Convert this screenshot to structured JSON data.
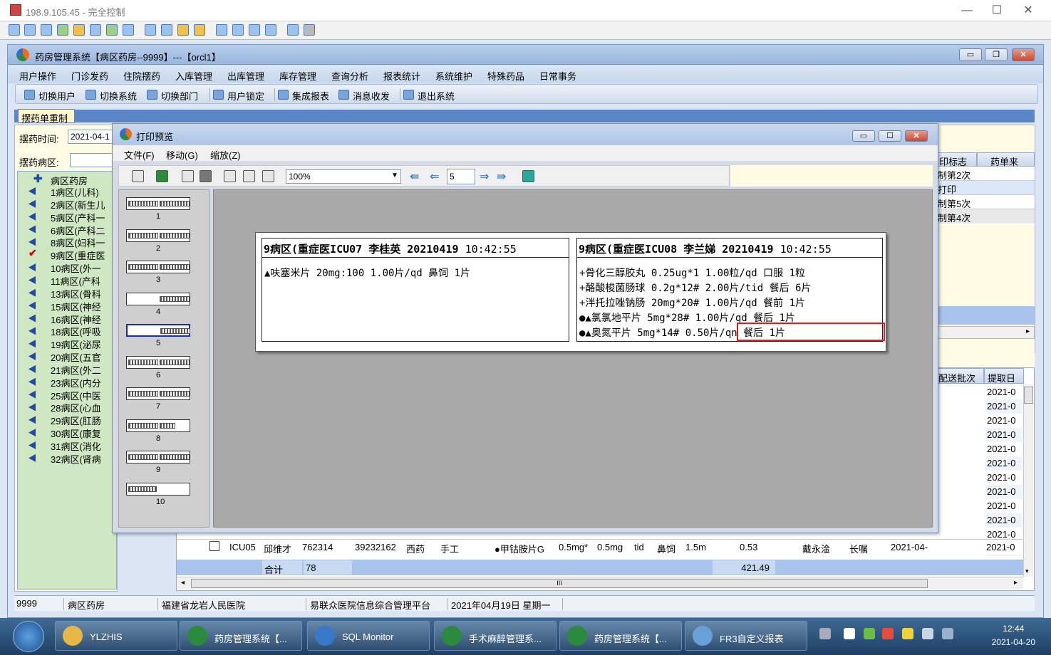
{
  "remote": {
    "title": "198.9.105.45 - 完全控制",
    "controls": [
      "—",
      "☐",
      "✕"
    ]
  },
  "app": {
    "title": "药房管理系统【病区药房--9999】---【orcl1】"
  },
  "menu": [
    "用户操作",
    "门诊发药",
    "住院摆药",
    "入库管理",
    "出库管理",
    "库存管理",
    "查询分析",
    "报表统计",
    "系统维护",
    "特殊药品",
    "日常事务"
  ],
  "toolbar": [
    "切换用户",
    "切换系统",
    "切换部门",
    "用户锁定",
    "集成报表",
    "消息收发",
    "退出系统"
  ],
  "tab": "摆药单重制",
  "form": {
    "time_label": "摆药时间:",
    "time_value": "2021-04-1",
    "ward_label": "摆药病区:"
  },
  "tree": {
    "root": "病区药房",
    "items": [
      "1病区(儿科)",
      "2病区(新生儿",
      "5病区(产科一",
      "6病区(产科二",
      "8病区(妇科一",
      "9病区(重症医",
      "10病区(外一",
      "11病区(产科",
      "13病区(骨科",
      "15病区(神经",
      "16病区(神经",
      "18病区(呼吸",
      "19病区(泌尿",
      "20病区(五官",
      "21病区(外二",
      "23病区(内分",
      "25病区(中医",
      "28病区(心血",
      "29病区(肛肠",
      "30病区(康复",
      "31病区(消化",
      "32病区(肾病"
    ],
    "checked_index": 5
  },
  "right_grid": {
    "headers": [
      "印标志",
      "药单来源"
    ],
    "rows": [
      "制第2次",
      "打印",
      "制第5次",
      "制第4次"
    ]
  },
  "lower_grid": {
    "headers": [
      "配送批次",
      "提取日"
    ],
    "dates": [
      "2021-0",
      "2021-0",
      "2021-0",
      "2021-0",
      "2021-0",
      "2021-0",
      "2021-0",
      "2021-0",
      "2021-0",
      "2021-0",
      "2021-0",
      "2021-0"
    ]
  },
  "bottom_row": {
    "bed": "ICU05",
    "name": "邱维才",
    "id": "762314",
    "no": "39232162",
    "type": "西药",
    "mode": "手工",
    "drug": "●甲钴胺片G",
    "spec": "0.5mg*",
    "dose": "0.5mg",
    "freq": "tid",
    "route": "鼻饲",
    "qty": "1.5m",
    "amount": "0.53",
    "doctor": "戴永淦",
    "kind": "长嘱",
    "date": "2021-04-",
    "batch": "2021-0"
  },
  "totals": {
    "label": "合计",
    "count": "78",
    "sum": "421.49"
  },
  "status": [
    "9999",
    "病区药房",
    "福建省龙岩人民医院",
    "易联众医院信息综合管理平台",
    "2021年04月19日 星期一"
  ],
  "preview": {
    "title": "打印预览",
    "menu": [
      "文件(F)",
      "移动(G)",
      "缩放(Z)"
    ],
    "zoom": "100%",
    "page": "5",
    "thumbs": [
      "1",
      "2",
      "3",
      "4",
      "5",
      "6",
      "7",
      "8",
      "9",
      "10"
    ],
    "slip1": {
      "header": "9病区(重症医ICU07 李桂英 20210419",
      "time": "10:42:55",
      "lines": [
        "▲呋塞米片        20mg:100   1.00片/qd     鼻饲 1片"
      ]
    },
    "slip2": {
      "header": "9病区(重症医ICU08 李兰娣 20210419",
      "time": "10:42:55",
      "lines": [
        "+骨化三醇胶丸    0.25ug*1   1.00粒/qd     口服 1粒",
        "+酪酸梭菌肠球    0.2g*12#   2.00片/tid    餐后 6片",
        "+泮托拉唑钠肠    20mg*20#   1.00片/qd     餐前 1片",
        "●▲氯氯地平片    5mg*28#    1.00片/qd     餐后 1片",
        "●▲奥氮平片      5mg*14#    0.50片/qn     餐后 1片"
      ]
    }
  },
  "taskbar": [
    {
      "label": "YLZHIS",
      "color": "#e8b74a"
    },
    {
      "label": "药房管理系统【...",
      "color": "#2b8a3e"
    },
    {
      "label": "SQL Monitor",
      "color": "#3a78c9"
    },
    {
      "label": "手术麻醉管理系...",
      "color": "#2b8a3e"
    },
    {
      "label": "药房管理系统【...",
      "color": "#2b8a3e"
    },
    {
      "label": "FR3自定义报表",
      "color": "#6aa0d8"
    }
  ],
  "clock": {
    "time": "12:44",
    "date": "2021-04-20"
  }
}
